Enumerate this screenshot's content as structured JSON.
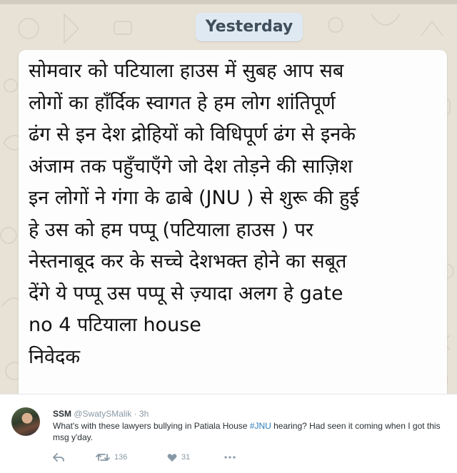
{
  "chat": {
    "date_label": "Yesterday",
    "message_lines": [
      "सोमवार को पटियाला हाउस में सुबह आप सब",
      "लोगों का हाँर्दिक स्वागत हे हम लोग शांतिपूर्ण",
      "ढंग से इन देश द्रोहियों को विधिपूर्ण ढंग से इनके",
      "अंजाम तक पहुँचाएँगे जो देश तोड़ने की साज़िश",
      "इन लोगों ने गंगा के ढाबे (JNU ) से शुरू की हुई",
      "हे उस को हम पप्पू (पटियाला हाउस ) पर",
      "नेस्तनाबूद कर के सच्चे देशभक्त होने का सबूत",
      "देंगे ये पप्पू उस पप्पू से ज़्यादा  अलग हे gate",
      "no 4 पटियाला house",
      "निवेदक"
    ]
  },
  "tweet": {
    "name": "SSM",
    "handle": "@SwatySMalik",
    "separator": "·",
    "time": "3h",
    "text_before_hashtag": "What's with these lawyers bullying in Patiala House ",
    "hashtag": "#JNU",
    "text_after_hashtag": " hearing? Had seen it coming when I got this msg y'day.",
    "retweet_count": "136",
    "like_count": "31",
    "icons": {
      "reply": "reply-icon",
      "retweet": "retweet-icon",
      "like": "heart-icon",
      "more": "more-icon"
    },
    "colors": {
      "hashtag": "#2b7bb9",
      "muted": "#8899a6",
      "text": "#292f33"
    }
  },
  "colors": {
    "chat_background": "#e7e1d6",
    "date_pill": "#dfe9f2",
    "bubble": "#fdfdfd"
  }
}
